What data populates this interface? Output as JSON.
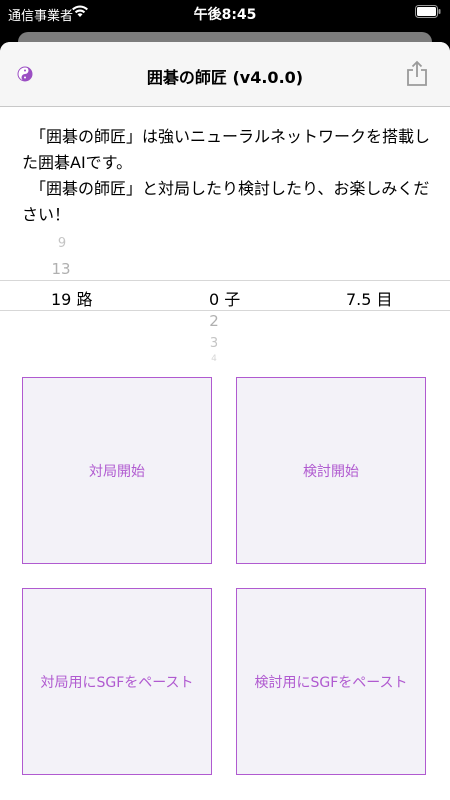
{
  "status": {
    "carrier": "通信事業者",
    "time": "午後8:45"
  },
  "nav": {
    "title": "囲碁の師匠 (v4.0.0)"
  },
  "intro": {
    "line1": "「囲碁の師匠」は強いニューラルネットワークを搭載した囲碁AIです。",
    "line2": "「囲碁の師匠」と対局したり検討したり、お楽しみください！"
  },
  "picker": {
    "board_size": {
      "above": [
        "9",
        "13"
      ],
      "selected": "19 路",
      "below": []
    },
    "handicap": {
      "above": [],
      "selected": "0 子",
      "below": [
        "2",
        "3",
        "4"
      ]
    },
    "komi": {
      "above": [],
      "selected": "7.5 目",
      "below": []
    }
  },
  "buttons": {
    "play_start": "対局開始",
    "review_start": "検討開始",
    "play_paste_sgf": "対局用にSGFをペースト",
    "review_paste_sgf": "検討用にSGFをペースト"
  },
  "colors": {
    "accent": "#b05ad0",
    "tile_bg": "#f3f2f8"
  }
}
